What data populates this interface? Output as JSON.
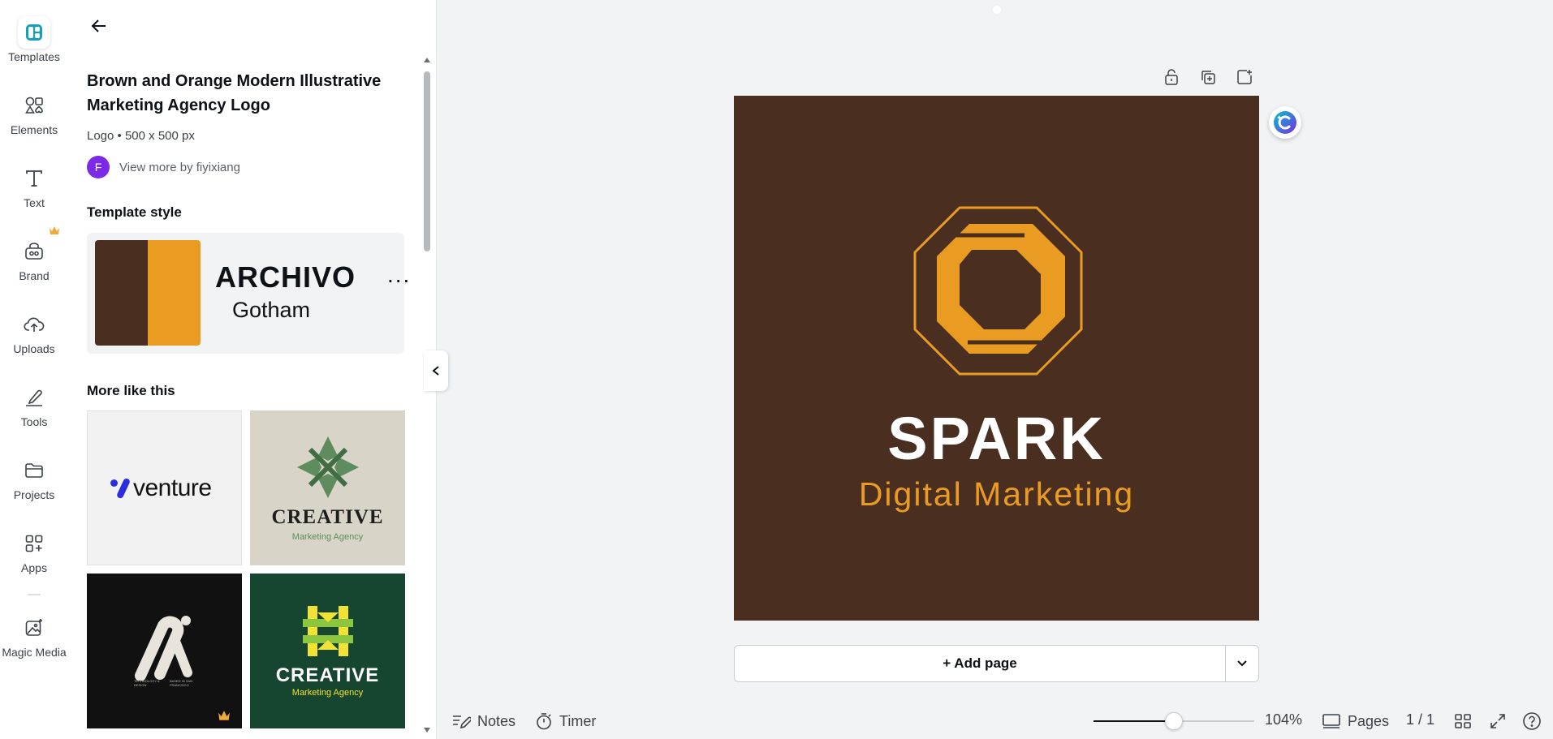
{
  "rail": {
    "items": [
      {
        "label": "Templates",
        "icon": "templates-icon"
      },
      {
        "label": "Elements",
        "icon": "elements-icon"
      },
      {
        "label": "Text",
        "icon": "text-icon"
      },
      {
        "label": "Brand",
        "icon": "brand-icon"
      },
      {
        "label": "Uploads",
        "icon": "uploads-icon"
      },
      {
        "label": "Tools",
        "icon": "tools-icon"
      },
      {
        "label": "Projects",
        "icon": "projects-icon"
      },
      {
        "label": "Apps",
        "icon": "apps-icon"
      },
      {
        "label": "Magic Media",
        "icon": "magic-media-icon"
      }
    ]
  },
  "panel": {
    "title": "Brown and Orange Modern Illustrative Marketing Agency Logo",
    "meta": "Logo • 500 x 500 px",
    "author_initial": "F",
    "author_text": "View more by fiyixiang",
    "style_heading": "Template style",
    "style": {
      "colors": [
        "#4a2e20",
        "#e99b22"
      ],
      "font_primary": "ARCHIVO",
      "font_more": "...",
      "font_secondary": "Gotham"
    },
    "more_heading": "More like this",
    "thumbs": {
      "venture": "venture",
      "creative1_title": "CREATIVE",
      "creative1_sub": "Marketing Agency",
      "dark_small_left": "TECHNOLOGY & DESIGN",
      "dark_small_right": "BASED IN SAN FRANCISCO",
      "creative2_title": "CREATIVE",
      "creative2_sub": "Marketing Agency"
    }
  },
  "design": {
    "title": "SPARK",
    "subtitle": "Digital Marketing",
    "background": "#4a2e20",
    "accent": "#e99b22"
  },
  "canvas": {
    "add_page": "+ Add page"
  },
  "bottom": {
    "notes": "Notes",
    "timer": "Timer",
    "zoom_level": 0.104,
    "zoom": "104%",
    "pages": "Pages",
    "page_count": "1 / 1"
  }
}
